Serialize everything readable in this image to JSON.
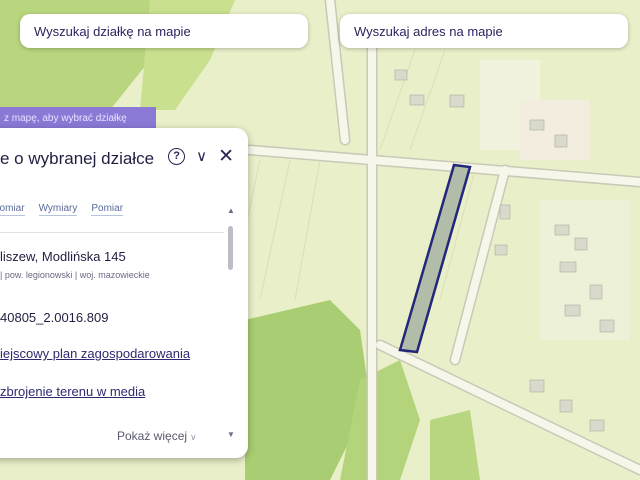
{
  "search": {
    "parcel_placeholder": "Wyszukaj działkę na mapie",
    "address_placeholder": "Wyszukaj adres na mapie"
  },
  "hint": "z mapę, aby wybrać działkę",
  "panel": {
    "title": "e o wybranej działce",
    "help_icon": "?",
    "collapse_icon": "∨",
    "close_icon": "✕",
    "tabs": [
      "pomiar",
      "Wymiary",
      "Pomiar"
    ],
    "address": "liszew, Modlińska 145",
    "region": "| pow. legionowski | woj. mazowieckie",
    "plot_id": "40805_2.0016.809",
    "links": [
      "iejscowy plan zagospodarowania",
      "zbrojenie terenu w media"
    ],
    "more": "Pokaż więcej",
    "more_icon": "∨",
    "scroll_up_icon": "▲",
    "scroll_down_icon": "▼"
  },
  "colors": {
    "map_base": "#e9f0c9",
    "forest": "#b9d67e",
    "road": "#f7f6ea",
    "parcel_fill": "#b2bda9",
    "parcel_stroke": "#23277a",
    "accent": "#8b79d6"
  }
}
